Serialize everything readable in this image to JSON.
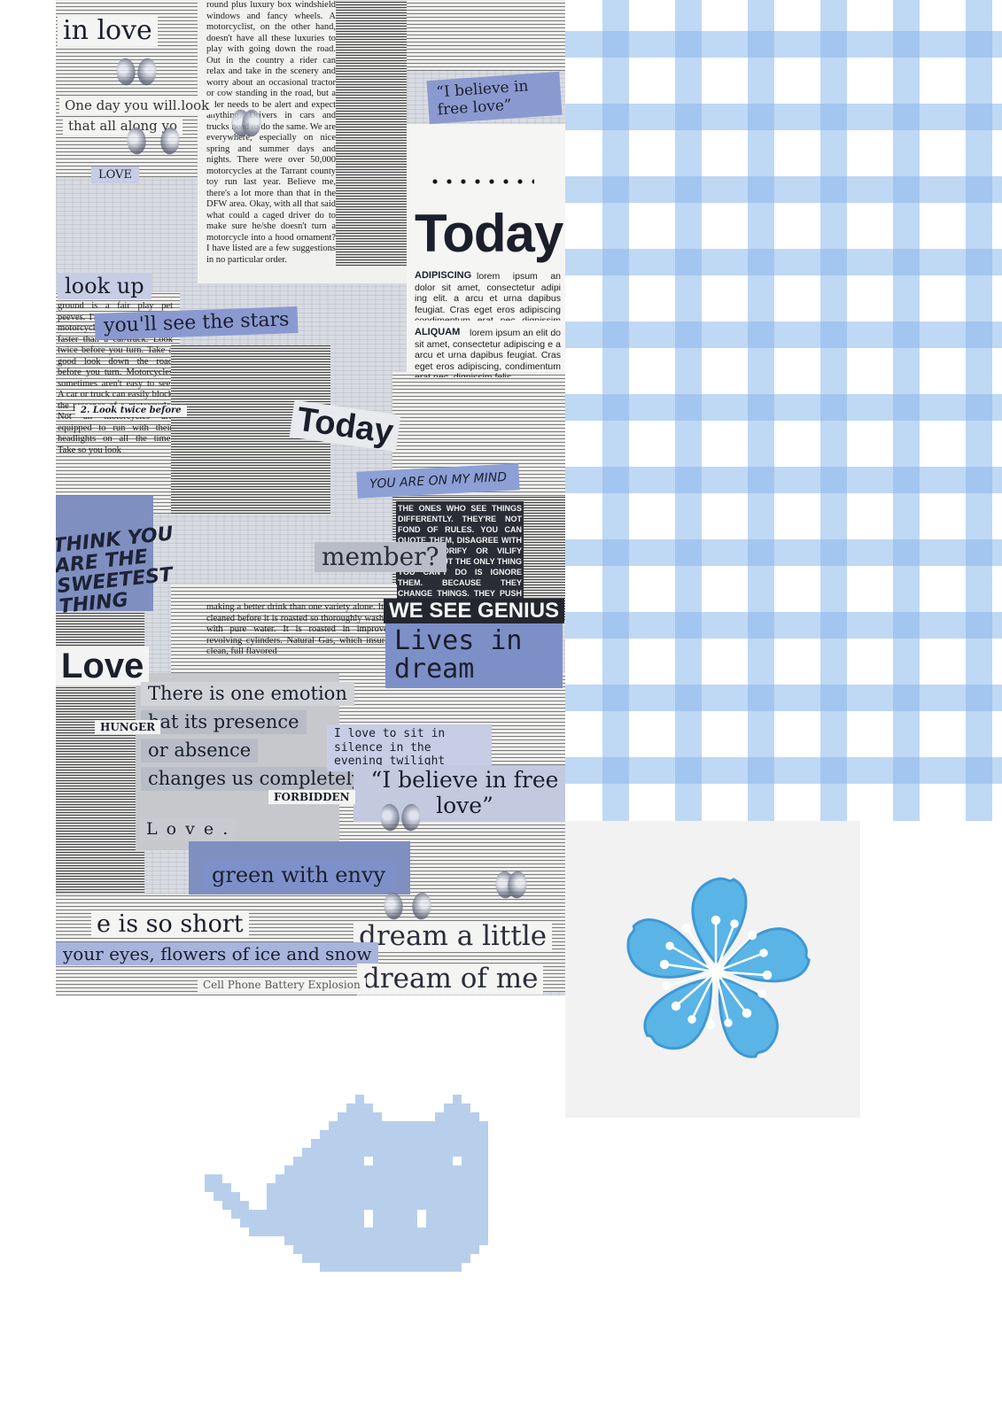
{
  "collage": {
    "snippets": {
      "in_love": "in love",
      "one_day": "One day you will.look",
      "that_all": "that all along yo",
      "love_stamp": "LOVE",
      "look_up": "look up",
      "see_stars": "you'll see the stars",
      "believe_top": "“I believe in free love”",
      "today_big": "Today",
      "adipiscing": "ADIPISCING",
      "aliquam": "ALIQUAM",
      "today_small": "Today",
      "you_are_on_my_mind": "YOU ARE ON MY MIND",
      "sweetest_thing": "THINK YOU ARE THE SWEETEST THING",
      "remember": "member?",
      "we_see_genius": "WE SEE GENIUS",
      "lives_in_dream": "Lives in dream",
      "love_big": "Love",
      "one_emotion": "There is one emotion",
      "presence": "hat its presence",
      "absence": "or absence",
      "changes_us": "changes us completely",
      "love_dots": "L o v e .",
      "alone_in_silence": "I love to sit in silence in the evening twilight",
      "believe_bottom": "“I believe in free love”",
      "green_with_envy": "green with envy",
      "is_so_short": "e is so short",
      "flowers_of_ice": "your eyes, flowers of ice and snow",
      "dream_a_little": "dream a little",
      "dream_of_me": "dream of me",
      "cell_phone": "Cell Phone Battery Explosion",
      "forbidden": "FORBIDDEN",
      "hunger": "HUNGER",
      "look_twice": "2. Look twice before",
      "ipsum_line": "lorem ipsum an dolor sit amet, consectetur adipi ing elit. a arcu et urna dapibus feugiat. Cras eget eros adipiscing condimentum erat nec dignissim felis.",
      "ipsum_line_2": "lorem ipsum an elit do sit amet, consectetur adipiscing e a arcu et urna dapibus feugiat. Cras eget eros adipiscing, condimentum erat nec, dignissim felis.",
      "column_1": "round plus luxury box windshield windows and fancy wheels. A motorcyclist, on the other hand, doesn't have all these luxuries to play with going down the road. Out in the country a rider can relax and take in the scenery and worry about an occasional tractor or cow standing in the road, but a rider needs to be alert and expect anything. Drivers in cars and trucks need to do the same. We are everywhere, especially on nice spring and summer days and nights. There were over 50,000 motorcycles at the Tarrant county toy run last year. Believe me, there's a lot more than that in the DFW area. Okay, with all that said what could a caged driver do to make sure he/she doesn't turn a motorcycle into a hood ornament? I have listed are a few suggestions in no particular order.",
      "column_2": "ground is a fair play pet peeves. I'm sure Remember a motorcycle can stop a lot faster than a car/truck. Look twice before you turn. Take a good look down the road before you turn. Motorcycles sometimes aren't easy to see. A car or truck can easily block the presence of a motorcycle. Not all motorcycles are equipped to run with their headlights on all the time. Take so you look",
      "column_3": "making a better drink than one variety alone. It is cleaned before it is roasted so thoroughly washed with pure water. It is roasted in improved revolving cylinders. Natural Gas, which insures clean, full flavored",
      "column_4": "THE ONES WHO SEE THINGS DIFFERENTLY. THEY'RE NOT FOND OF RULES. YOU CAN QUOTE THEM, DISAGREE WITH THEM, GLORIFY OR VILIFY THEM. ABOUT THE ONLY THING YOU CAN'T DO IS IGNORE THEM. BECAUSE THEY CHANGE THINGS. THEY PUSH THE HUMAN RACE FORWARD. WHILE SOME MAY SEE THEM AS THE CRAZY ONES"
    }
  },
  "colors": {
    "gingham_blue": "#8ab8ec",
    "flower_blue": "#5ab4e6",
    "flower_edge": "#3f98d4",
    "cat_blue": "#b8cfec",
    "collage_blue": "#8a9ad0"
  }
}
